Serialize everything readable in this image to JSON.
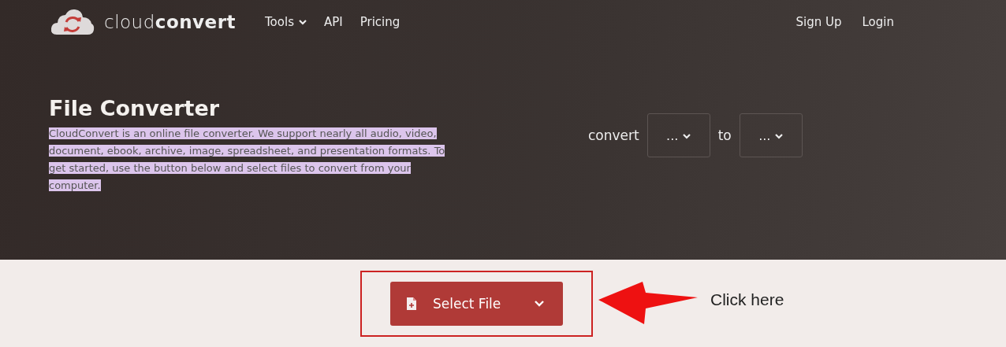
{
  "header": {
    "logo": {
      "light": "cloud",
      "bold": "convert"
    },
    "nav": [
      {
        "label": "Tools",
        "dropdown": true
      },
      {
        "label": "API",
        "dropdown": false
      },
      {
        "label": "Pricing",
        "dropdown": false
      }
    ],
    "account": [
      "Sign Up",
      "Login"
    ]
  },
  "hero": {
    "title": "File Converter",
    "description": {
      "text": "CloudConvert is an online file converter. We support nearly all audio, video, document, ebook, archive, image, spreadsheet, and presentation formats. To get started, use the button below and select files to convert from your computer.",
      "selected": true
    },
    "convert_label": "convert",
    "from": "...",
    "to_label": "to",
    "to": "..."
  },
  "select_button": {
    "label": "Select File"
  },
  "annotation": {
    "text": "Click here"
  }
}
